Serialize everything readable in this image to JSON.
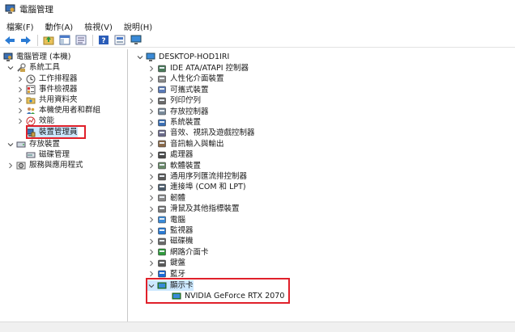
{
  "window": {
    "title": "電腦管理",
    "app_icon": "computer-management-icon"
  },
  "menu": [
    "檔案(F)",
    "動作(A)",
    "檢視(V)",
    "說明(H)"
  ],
  "toolbar": {
    "buttons": [
      "back-arrow-icon",
      "forward-arrow-icon",
      "up-folder-icon",
      "show-hide-tree-icon",
      "export-list-icon",
      "help-icon",
      "properties-icon",
      "monitor-icon"
    ]
  },
  "left_tree": {
    "root": "電腦管理 (本機)",
    "system_tools": "系統工具",
    "task_scheduler": "工作排程器",
    "event_viewer": "事件檢視器",
    "shared_folders": "共用資料夾",
    "local_users": "本機使用者和群組",
    "performance": "效能",
    "device_manager": "裝置管理員",
    "storage": "存放裝置",
    "disk_management": "磁碟管理",
    "services": "服務與應用程式"
  },
  "device_tree": {
    "computer": "DESKTOP-HOD1IRI",
    "categories": [
      "IDE ATA/ATAPI 控制器",
      "人性化介面裝置",
      "可攜式裝置",
      "列印佇列",
      "存放控制器",
      "系統裝置",
      "音效、視訊及遊戲控制器",
      "音訊輸入與輸出",
      "處理器",
      "軟體裝置",
      "通用序列匯流排控制器",
      "連接埠 (COM 和 LPT)",
      "韌體",
      "滑鼠及其他指標裝置",
      "電腦",
      "監視器",
      "磁碟機",
      "網路介面卡",
      "鍵盤",
      "藍牙"
    ],
    "display_adapters": "顯示卡",
    "gpu": "NVIDIA GeForce RTX 2070"
  },
  "colors": {
    "highlight": "#e0202a",
    "selection": "#cce8ff"
  }
}
